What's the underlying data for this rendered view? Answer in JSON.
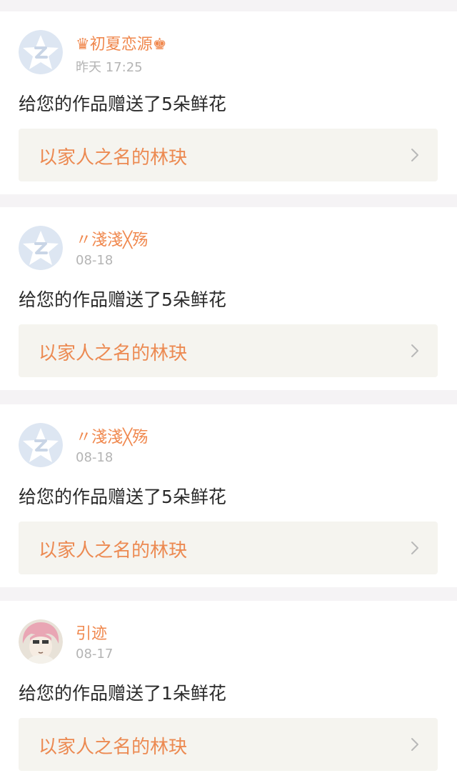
{
  "notifications": [
    {
      "username": "♛初夏恋源♚",
      "timestamp": "昨天 17:25",
      "message": "给您的作品赠送了5朵鲜花",
      "work_title": "以家人之名的林玦",
      "avatar": "qzone-default-avatar"
    },
    {
      "username": "〃淺淺╳殇",
      "timestamp": "08-18",
      "message": "给您的作品赠送了5朵鲜花",
      "work_title": "以家人之名的林玦",
      "avatar": "qzone-default-avatar"
    },
    {
      "username": "〃淺淺╳殇",
      "timestamp": "08-18",
      "message": "给您的作品赠送了5朵鲜花",
      "work_title": "以家人之名的林玦",
      "avatar": "qzone-default-avatar"
    },
    {
      "username": "引迹",
      "timestamp": "08-17",
      "message": "给您的作品赠送了1朵鲜花",
      "work_title": "以家人之名的林玦",
      "avatar": "anime-photo-avatar"
    }
  ],
  "colors": {
    "accent": "#f0884e",
    "card_link_bg": "#f5f4ef",
    "divider_bg": "#f5f3f5",
    "timestamp": "#b4b4b4",
    "text": "#2a2a2a"
  },
  "icons": {
    "chevron": "chevron-right-icon"
  }
}
